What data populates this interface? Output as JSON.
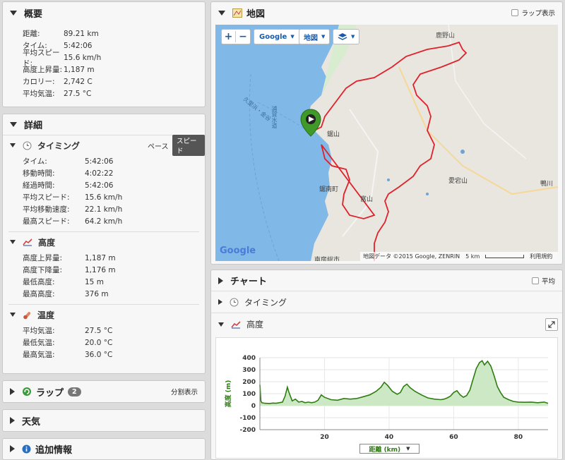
{
  "summary": {
    "title": "概要",
    "rows": [
      {
        "k": "距離:",
        "v": "89.21 km"
      },
      {
        "k": "タイム:",
        "v": "5:42:06"
      },
      {
        "k": "平均スピード:",
        "v": "15.6 km/h"
      },
      {
        "k": "高度上昇量:",
        "v": "1,187 m"
      },
      {
        "k": "カロリー:",
        "v": "2,742 C"
      },
      {
        "k": "平均気温:",
        "v": "27.5 °C"
      }
    ]
  },
  "details": {
    "title": "詳細",
    "timing": {
      "title": "タイミング",
      "pace_label": "ペース",
      "speed_label": "スピード",
      "rows": [
        {
          "k": "タイム:",
          "v": "5:42:06"
        },
        {
          "k": "移動時間:",
          "v": "4:02:22"
        },
        {
          "k": "経過時間:",
          "v": "5:42:06"
        },
        {
          "k": "平均スピード:",
          "v": "15.6 km/h"
        },
        {
          "k": "平均移動速度:",
          "v": "22.1 km/h"
        },
        {
          "k": "最高スピード:",
          "v": "64.2 km/h"
        }
      ]
    },
    "elevation": {
      "title": "高度",
      "rows": [
        {
          "k": "高度上昇量:",
          "v": "1,187 m"
        },
        {
          "k": "高度下降量:",
          "v": "1,176 m"
        },
        {
          "k": "最低高度:",
          "v": "15 m"
        },
        {
          "k": "最高高度:",
          "v": "376 m"
        }
      ]
    },
    "temperature": {
      "title": "温度",
      "rows": [
        {
          "k": "平均気温:",
          "v": "27.5 °C"
        },
        {
          "k": "最低気温:",
          "v": "20.0 °C"
        },
        {
          "k": "最高気温:",
          "v": "36.0 °C"
        }
      ]
    }
  },
  "laps": {
    "title": "ラップ",
    "count": "2",
    "split_label": "分割表示"
  },
  "weather": {
    "title": "天気"
  },
  "extra": {
    "title": "追加情報"
  },
  "map": {
    "title": "地図",
    "lap_toggle": "ラップ表示",
    "zoom_in": "+",
    "zoom_out": "−",
    "provider_btn": "Google",
    "type_btn": "地図",
    "attribution": "地図データ ©2015 Google, ZENRIN",
    "scale": "5 km",
    "terms": "利用規約",
    "google_logo": "Google",
    "labels": {
      "kanozan": "鹿野山",
      "nokogiri": "鋸山",
      "kyonan": "鋸南町",
      "tomiyama": "富山",
      "atagoyama": "愛宕山",
      "kamogawa": "鴨川",
      "minamiboso": "南房総市",
      "strait1": "久里浜・金谷",
      "strait2": "浦賀水道"
    }
  },
  "chart_panel": {
    "title": "チャート",
    "flat_toggle": "平均",
    "timing_label": "タイミング",
    "elevation_label": "高度",
    "x_selector": "距離 (km)"
  },
  "chart_data": {
    "type": "area",
    "title": "",
    "xlabel": "距離 (km)",
    "ylabel": "高度 (m)",
    "xlim": [
      0,
      89.21
    ],
    "ylim": [
      -200,
      400
    ],
    "xticks": [
      20,
      40,
      60,
      80
    ],
    "yticks": [
      400,
      300,
      200,
      100,
      0,
      -100,
      -200
    ],
    "color": "#2e7d12",
    "fill": "#cde8c4",
    "series": [
      {
        "x": [
          0,
          0.3,
          0.6,
          1.5,
          3,
          4,
          5,
          6,
          7,
          7.8,
          8.5,
          9,
          10,
          11,
          12,
          13,
          14,
          15,
          16,
          17,
          18,
          19,
          20,
          22,
          24,
          26,
          28,
          30,
          32,
          34,
          36,
          37.5,
          38.5,
          39.5,
          41,
          42.5,
          43.5,
          44.5,
          45.5,
          46.5,
          48,
          50,
          52,
          54,
          56,
          57,
          58,
          59,
          60,
          61,
          62,
          63,
          64,
          65,
          66,
          67,
          68,
          68.8,
          69.5,
          70.5,
          71.5,
          72.5,
          73.5,
          74.5,
          75.5,
          77,
          78.5,
          80,
          82,
          84,
          86,
          88,
          89.21
        ],
        "y": [
          175,
          40,
          25,
          20,
          18,
          22,
          20,
          25,
          30,
          80,
          155,
          110,
          40,
          55,
          30,
          35,
          25,
          30,
          25,
          30,
          45,
          90,
          70,
          50,
          45,
          60,
          55,
          60,
          75,
          90,
          120,
          155,
          195,
          170,
          120,
          95,
          110,
          160,
          180,
          150,
          120,
          90,
          65,
          55,
          50,
          55,
          65,
          80,
          110,
          125,
          90,
          70,
          85,
          130,
          220,
          310,
          360,
          375,
          340,
          370,
          330,
          250,
          160,
          110,
          70,
          50,
          35,
          30,
          28,
          30,
          25,
          30,
          20
        ]
      }
    ]
  }
}
